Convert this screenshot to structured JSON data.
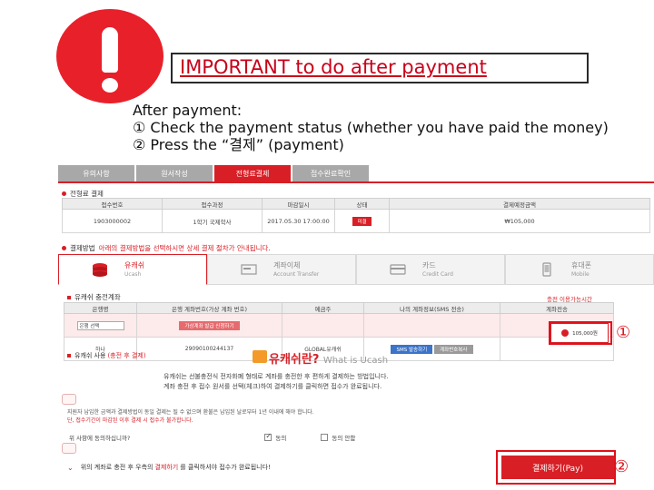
{
  "header": {
    "alert_icon": "exclamation-circle-icon",
    "title": "IMPORTANT to do after payment",
    "instruction_intro": "After payment:",
    "instruction_1": "① Check the payment status (whether you have paid the money)",
    "instruction_2": "② Press the “결제” (payment)"
  },
  "screenshot": {
    "steps": [
      {
        "label": "유의사항",
        "active": false
      },
      {
        "label": "원서작성",
        "active": false
      },
      {
        "label": "전형료결제",
        "active": true
      },
      {
        "label": "접수완료확인",
        "active": false
      }
    ],
    "accent_color": "#d81f26",
    "section1_title": "전형료 결제",
    "table1": {
      "headers": [
        "접수번호",
        "접수과정",
        "마감일시",
        "상태",
        "결제예정금액"
      ],
      "row": [
        "1903000002",
        "1학기 국제학사",
        "2017.05.30 17:00:00",
        "미결",
        "₩105,000"
      ]
    },
    "section2_title_prefix": "결제방법",
    "section2_title_text": "아래의 결제방법을 선택하시면 상세 결제 절차가 안내됩니다.",
    "method_tabs": [
      {
        "label": "유캐쉬",
        "sub": "Ucash",
        "icon": "coin-stack-icon",
        "active": true
      },
      {
        "label": "계좌이체",
        "sub": "Account Transfer",
        "icon": "bank-card-icon",
        "active": false
      },
      {
        "label": "카드",
        "sub": "Credit Card",
        "icon": "credit-card-icon",
        "active": false
      },
      {
        "label": "휴대폰",
        "sub": "Mobile",
        "icon": "mobile-phone-icon",
        "active": false
      }
    ],
    "ucash_title": "유캐쉬 충전계좌",
    "ucash_right_link": "충전 이용가능시간",
    "table2": {
      "headers": [
        "은행명",
        "은행 계좌번호(가상 계좌 번호)",
        "예금주",
        "나의 계좌정보(SMS 전송)",
        "계좌전송"
      ],
      "bank_select": "은행 선택",
      "virtual_account_button": "가상계좌 발급 신청하기",
      "bank": "하나",
      "account_number": "29090100244137",
      "holder": "GLOBAL유캐쉬",
      "sms_button": "SMS 발송하기",
      "copy_button": "계좌번호복사"
    },
    "balance_text": "105,000원",
    "ucash_use_title": "유캐쉬 사용",
    "ucash_use_note": "(충전 후 결제)",
    "help_title": "유캐쉬란?",
    "help_title_en": "What is Ucash",
    "help_lines": [
      "유캐쉬는 선불충전식 전자화폐 형태로 계좌를 충전한 후 편하게 결제하는 방법입니다.",
      "계좌 충전 후 접수 원서를 선택(체크)하여 결제하기를 클릭하면 접수가 완료됩니다."
    ],
    "notice_text": "지원자 납입한 금액과 결제방법이 동일 결제는 될 수 없으며 환불은 납입된 날로부터 1년 이내에 해야 합니다.",
    "notice_text_2": "단, 접수기간이 마감된 이후 결제 시 접수가 불가합니다.",
    "agree_question": "위 사항에 동의하십니까?",
    "agree_yes": "동의",
    "agree_no": "동의 안함",
    "final_text_prefix": "위의 계좌로 충전 후 우측의",
    "final_text_em": "결제하기",
    "final_text_suffix": "를 클릭하셔야 접수가 완료됩니다!",
    "pay_button": "결제하기(Pay)",
    "marker_1": "①",
    "marker_2": "②"
  }
}
